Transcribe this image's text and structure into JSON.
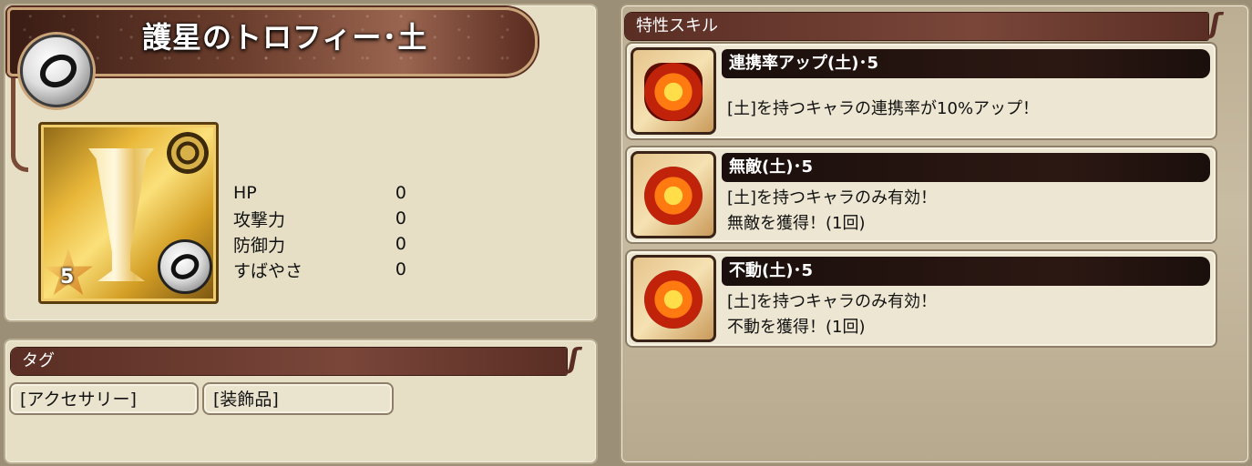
{
  "item": {
    "title": "護星のトロフィー･土",
    "rarity": "5",
    "stats": [
      {
        "label": "HP",
        "value": "0"
      },
      {
        "label": "攻撃力",
        "value": "0"
      },
      {
        "label": "防御力",
        "value": "0"
      },
      {
        "label": "すばやさ",
        "value": "0"
      }
    ]
  },
  "tags": {
    "header": "タグ",
    "items": [
      "[アクセサリー]",
      "[装飾品]"
    ]
  },
  "skills": {
    "header": "特性スキル",
    "items": [
      {
        "name": "連携率アップ(土)･5",
        "desc1": "[土]を持つキャラの連携率が10%アップ！",
        "desc2": "",
        "icon": "link-rate-up-icon"
      },
      {
        "name": "無敵(土)･5",
        "desc1": "[土]を持つキャラのみ有効！",
        "desc2": "無敵を獲得！(1回)",
        "icon": "invincible-shield-icon"
      },
      {
        "name": "不動(土)･5",
        "desc1": "[土]を持つキャラのみ有効！",
        "desc2": "不動を獲得！(1回)",
        "icon": "immovable-icon"
      }
    ]
  },
  "colors": {
    "panel_bg": "#e6dfc6",
    "header_bg": "#6a3a2e",
    "skill_name_bg": "#1f120e"
  }
}
